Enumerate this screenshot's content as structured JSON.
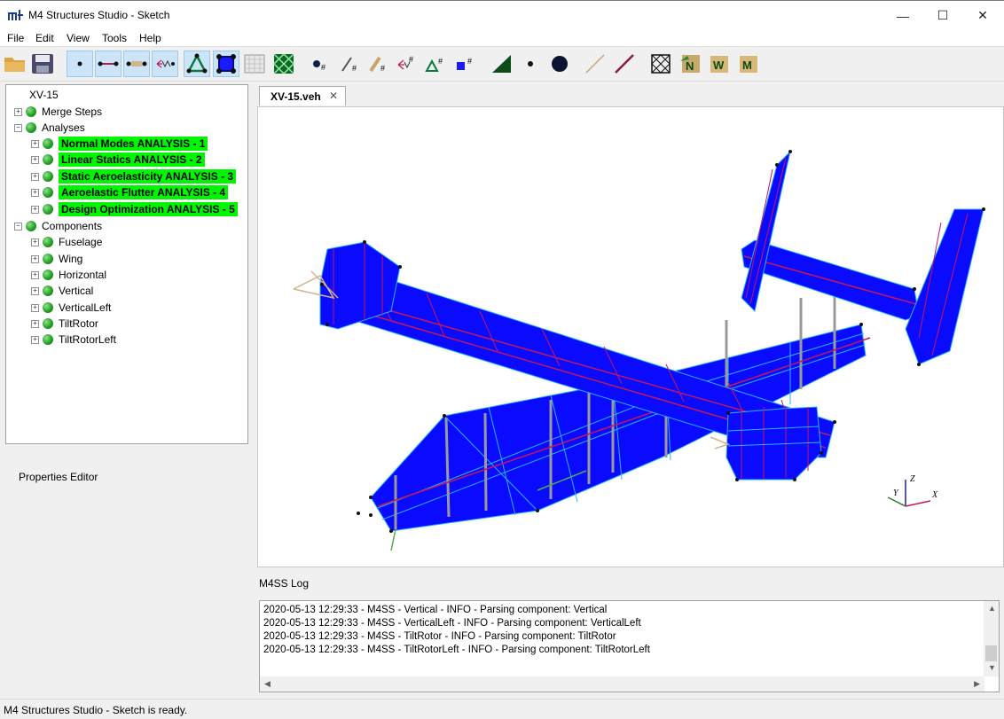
{
  "window": {
    "title": "M4 Structures Studio - Sketch",
    "minimize": "—",
    "maximize": "☐",
    "close": "✕"
  },
  "menu": [
    "File",
    "Edit",
    "View",
    "Tools",
    "Help"
  ],
  "toolbar": {
    "icons": [
      "open-folder-icon",
      "save-icon",
      "node-mode-icon",
      "beam-mode-icon",
      "rod-mode-icon",
      "spring-mode-icon",
      "triangle-element-icon",
      "quad-element-icon",
      "mesh-hatch-icon",
      "solid-mesh-icon",
      "node-number-icon",
      "line-number-icon",
      "bar-number-icon",
      "spring-number-icon",
      "tri-number-icon",
      "quad-number-icon",
      "fill-triangle-icon",
      "small-dot-icon",
      "large-dot-icon",
      "thin-line-icon",
      "thick-line-icon",
      "wireframe-cube-icon",
      "n-script-icon",
      "w-script-icon",
      "m-script-icon"
    ],
    "selected": [
      2,
      3,
      4,
      5,
      6,
      7
    ]
  },
  "tree": {
    "root": "XV-15",
    "nodes": [
      {
        "label": "Merge Steps",
        "level": 0,
        "highlight": false
      },
      {
        "label": "Analyses",
        "level": 0,
        "highlight": false,
        "expanded": true
      },
      {
        "label": "Normal Modes ANALYSIS - 1",
        "level": 1,
        "highlight": true
      },
      {
        "label": "Linear Statics ANALYSIS - 2",
        "level": 1,
        "highlight": true
      },
      {
        "label": "Static Aeroelasticity ANALYSIS - 3",
        "level": 1,
        "highlight": true
      },
      {
        "label": "Aeroelastic Flutter ANALYSIS - 4",
        "level": 1,
        "highlight": true
      },
      {
        "label": "Design Optimization ANALYSIS - 5",
        "level": 1,
        "highlight": true
      },
      {
        "label": "Components",
        "level": 0,
        "highlight": false,
        "expanded": true
      },
      {
        "label": "Fuselage",
        "level": 1,
        "highlight": false
      },
      {
        "label": "Wing",
        "level": 1,
        "highlight": false
      },
      {
        "label": "Horizontal",
        "level": 1,
        "highlight": false
      },
      {
        "label": "Vertical",
        "level": 1,
        "highlight": false
      },
      {
        "label": "VerticalLeft",
        "level": 1,
        "highlight": false
      },
      {
        "label": "TiltRotor",
        "level": 1,
        "highlight": false
      },
      {
        "label": "TiltRotorLeft",
        "level": 1,
        "highlight": false
      }
    ]
  },
  "properties_editor": "Properties Editor",
  "document": {
    "tab_label": "XV-15.veh",
    "tab_close": "✕"
  },
  "axes": {
    "x": "X",
    "y": "Y",
    "z": "Z"
  },
  "log": {
    "title": "M4SS Log",
    "lines": [
      "2020-05-13 12:29:33 - M4SS - Vertical - INFO - Parsing component: Vertical",
      "2020-05-13 12:29:33 - M4SS - VerticalLeft - INFO - Parsing component: VerticalLeft",
      "2020-05-13 12:29:33 - M4SS - TiltRotor - INFO - Parsing component: TiltRotor",
      "2020-05-13 12:29:33 - M4SS - TiltRotorLeft - INFO - Parsing component: TiltRotorLeft"
    ]
  },
  "status": "M4 Structures Studio - Sketch is ready.",
  "colors": {
    "mesh_fill": "#0a0aff",
    "mesh_edge": "#29b6f6",
    "beam": "#c2185b",
    "highlight": "#00f500",
    "node": "#111111"
  }
}
